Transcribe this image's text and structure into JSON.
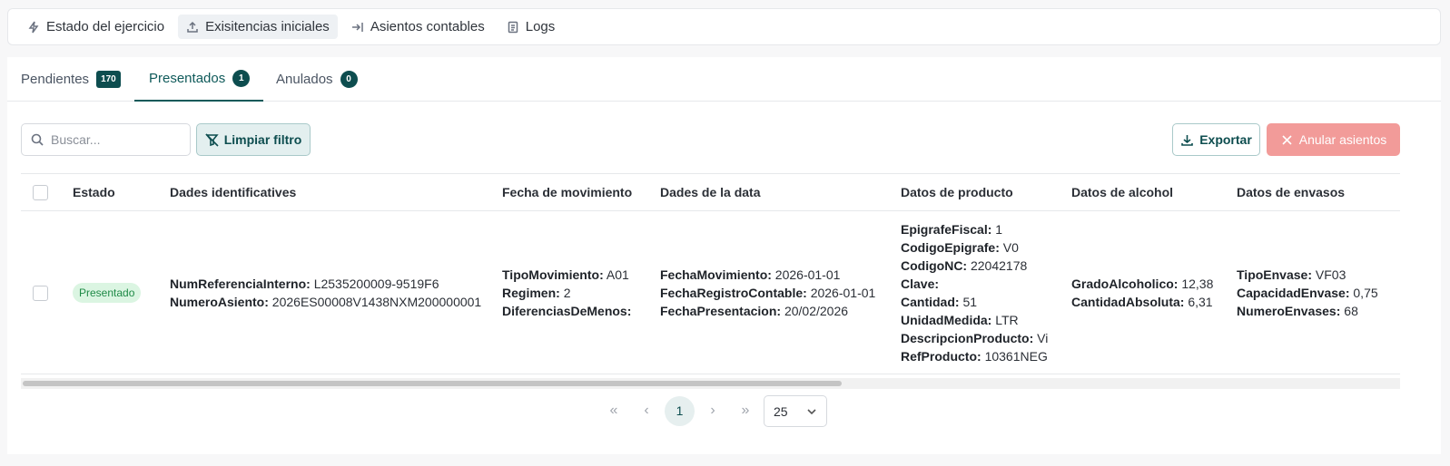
{
  "nav": {
    "items": [
      {
        "label": "Estado del ejercicio",
        "icon": "bolt-icon"
      },
      {
        "label": "Exisitencias iniciales",
        "icon": "upload-icon",
        "active": true
      },
      {
        "label": "Asientos contables",
        "icon": "arrow-into-icon"
      },
      {
        "label": "Logs",
        "icon": "document-icon"
      }
    ]
  },
  "tabs": [
    {
      "label": "Pendientes",
      "count": "170"
    },
    {
      "label": "Presentados",
      "count": "1",
      "active": true
    },
    {
      "label": "Anulados",
      "count": "0"
    }
  ],
  "toolbar": {
    "search_placeholder": "Buscar...",
    "clear_filter_label": "Limpiar filtro",
    "export_label": "Exportar",
    "anular_label": "Anular asientos"
  },
  "table": {
    "headers": [
      "Estado",
      "Dades identificatives",
      "Fecha de movimiento",
      "Dades de la data",
      "Datos de producto",
      "Datos de alcohol",
      "Datos de envasos"
    ],
    "rows": [
      {
        "estado": "Presentado",
        "identificativos": [
          {
            "k": "NumReferenciaInterno:",
            "v": "L2535200009-9519F6"
          },
          {
            "k": "NumeroAsiento:",
            "v": "2026ES00008V1438NXM200000001"
          }
        ],
        "movimiento": [
          {
            "k": "TipoMovimiento:",
            "v": "A01"
          },
          {
            "k": "Regimen:",
            "v": "2"
          },
          {
            "k": "DiferenciasDeMenos:",
            "v": ""
          }
        ],
        "data": [
          {
            "k": "FechaMovimiento:",
            "v": "2026-01-01"
          },
          {
            "k": "FechaRegistroContable:",
            "v": "2026-01-01"
          },
          {
            "k": "FechaPresentacion:",
            "v": "20/02/2026"
          }
        ],
        "producto": [
          {
            "k": "EpigrafeFiscal:",
            "v": "1"
          },
          {
            "k": "CodigoEpigrafe:",
            "v": "V0"
          },
          {
            "k": "CodigoNC:",
            "v": "22042178"
          },
          {
            "k": "Clave:",
            "v": ""
          },
          {
            "k": "Cantidad:",
            "v": "51"
          },
          {
            "k": "UnidadMedida:",
            "v": "LTR"
          },
          {
            "k": "DescripcionProducto:",
            "v": "Vi"
          },
          {
            "k": "RefProducto:",
            "v": "10361NEG"
          }
        ],
        "alcohol": [
          {
            "k": "GradoAlcoholico:",
            "v": "12,38"
          },
          {
            "k": "CantidadAbsoluta:",
            "v": "6,31"
          }
        ],
        "envasos": [
          {
            "k": "TipoEnvase:",
            "v": "VF03"
          },
          {
            "k": "CapacidadEnvase:",
            "v": "0,75"
          },
          {
            "k": "NumeroEnvases:",
            "v": "68"
          }
        ]
      }
    ]
  },
  "pagination": {
    "first": "«",
    "prev": "‹",
    "current_page": "1",
    "next": "›",
    "last": "»",
    "page_size": "25"
  },
  "colors": {
    "accent": "#0d4d4f",
    "status_green_bg": "#dbf5e2",
    "status_green_text": "#1f8a47",
    "danger_disabled": "#f29b99"
  }
}
